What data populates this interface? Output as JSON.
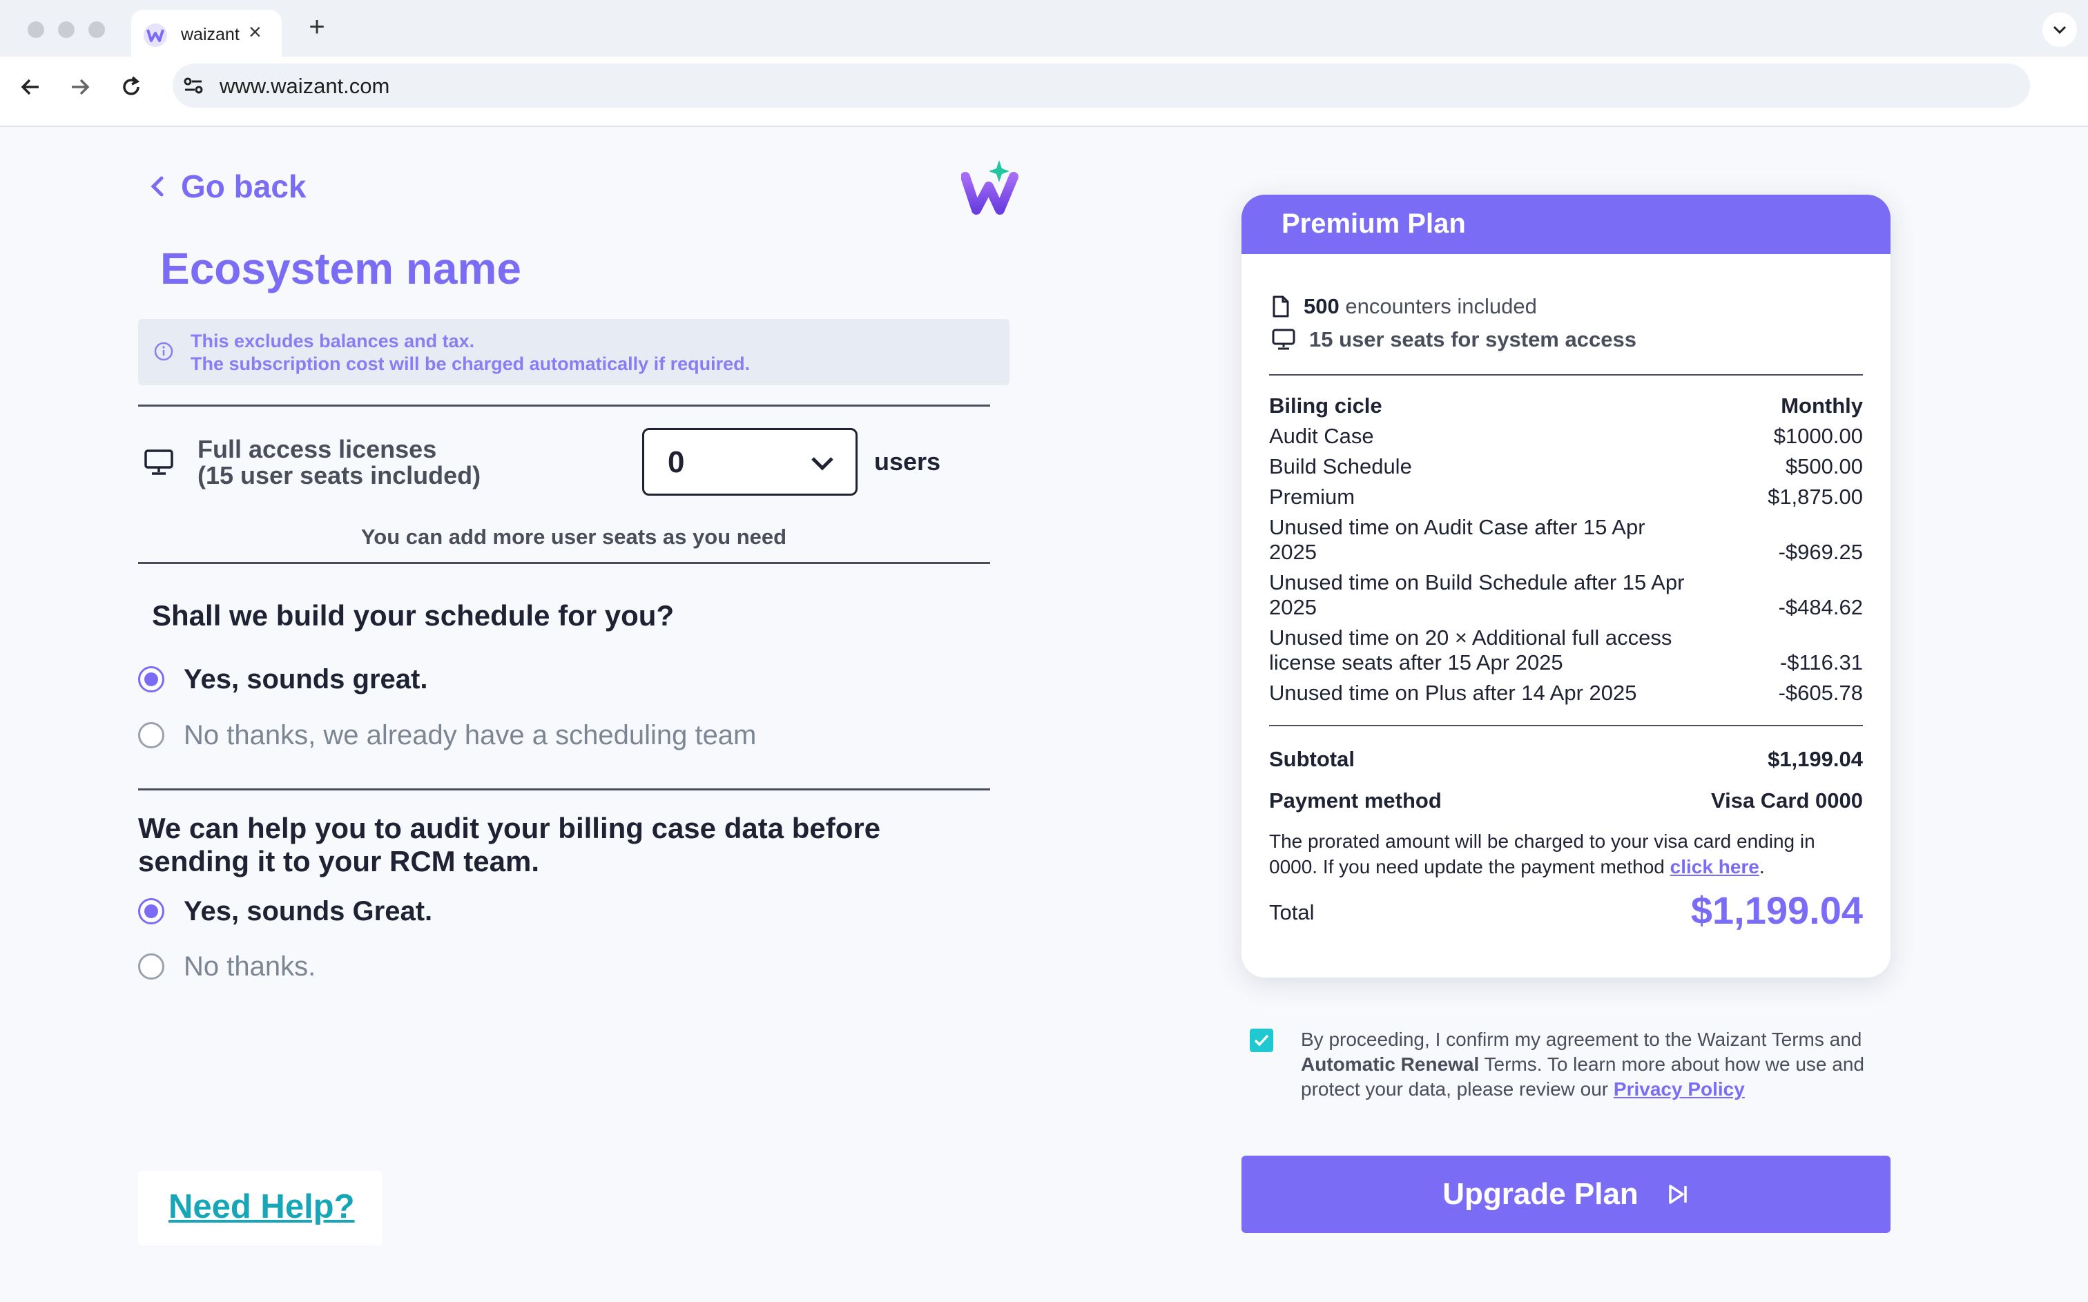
{
  "browser": {
    "tab_title": "waizant",
    "tab_close": "×",
    "new_tab": "+",
    "url": "www.waizant.com"
  },
  "nav": {
    "go_back": "Go back"
  },
  "page": {
    "title": "Ecosystem name",
    "info_line1": "This excludes balances and tax.",
    "info_line2": "The subscription cost will be charged automatically if required."
  },
  "licenses": {
    "label_line1": "Full access licenses",
    "label_line2": "(15 user seats included)",
    "selected_value": "0",
    "unit": "users",
    "hint": "You can add more user seats as you need"
  },
  "schedule_question": {
    "question": "Shall we build your schedule for you?",
    "options": [
      {
        "label": "Yes, sounds great.",
        "selected": true
      },
      {
        "label": "No thanks, we already have a scheduling team",
        "selected": false
      }
    ]
  },
  "audit_question": {
    "question_line1": "We can help you to audit your billing case data before",
    "question_line2": "sending it to your RCM team.",
    "options": [
      {
        "label": "Yes, sounds Great.",
        "selected": true
      },
      {
        "label": "No thanks.",
        "selected": false
      }
    ]
  },
  "help": {
    "link": "Need Help?"
  },
  "plan": {
    "name": "Premium Plan",
    "features": [
      {
        "icon": "document-icon",
        "bold": "500",
        "text": " encounters included"
      },
      {
        "icon": "monitor-icon",
        "bold": "",
        "text": "15 user seats for system access"
      }
    ],
    "billing_cycle_label": "Biling cicle",
    "billing_cycle_value": "Monthly",
    "line_items": [
      {
        "label": "Audit Case",
        "amount": "$1000.00"
      },
      {
        "label": "Build Schedule",
        "amount": "$500.00"
      },
      {
        "label": "Premium",
        "amount": "$1,875.00"
      },
      {
        "label_line1": "Unused time on Audit Case after 15 Apr",
        "label_line2": "2025",
        "amount": "-$969.25"
      },
      {
        "label_line1": "Unused time on Build Schedule after 15 Apr",
        "label_line2": "2025",
        "amount": "-$484.62"
      },
      {
        "label_line1": "Unused time on 20 × Additional full access",
        "label_line2": "license seats after 15 Apr 2025",
        "amount": "-$116.31"
      },
      {
        "label": "Unused time on Plus after 14 Apr 2025",
        "amount": "-$605.78"
      }
    ],
    "subtotal_label": "Subtotal",
    "subtotal_value": "$1,199.04",
    "payment_label": "Payment method",
    "payment_value": "Visa Card 0000",
    "note_text": "The prorated amount will be charged to your visa card ending in 0000. If you need update the payment method ",
    "note_link": "click here",
    "note_end": ".",
    "total_label": "Total",
    "total_value": "$1,199.04"
  },
  "terms": {
    "checked": true,
    "part1": "By proceeding, I confirm my agreement to the Waizant Terms and ",
    "bold": "Automatic Renewal",
    "part2": " Terms. To learn more about how we use and protect your data, please review our ",
    "link": "Privacy Policy"
  },
  "cta": {
    "label": "Upgrade Plan"
  },
  "colors": {
    "accent": "#7b6cf6",
    "teal": "#1fc9cf",
    "help_link": "#17a6b8"
  }
}
